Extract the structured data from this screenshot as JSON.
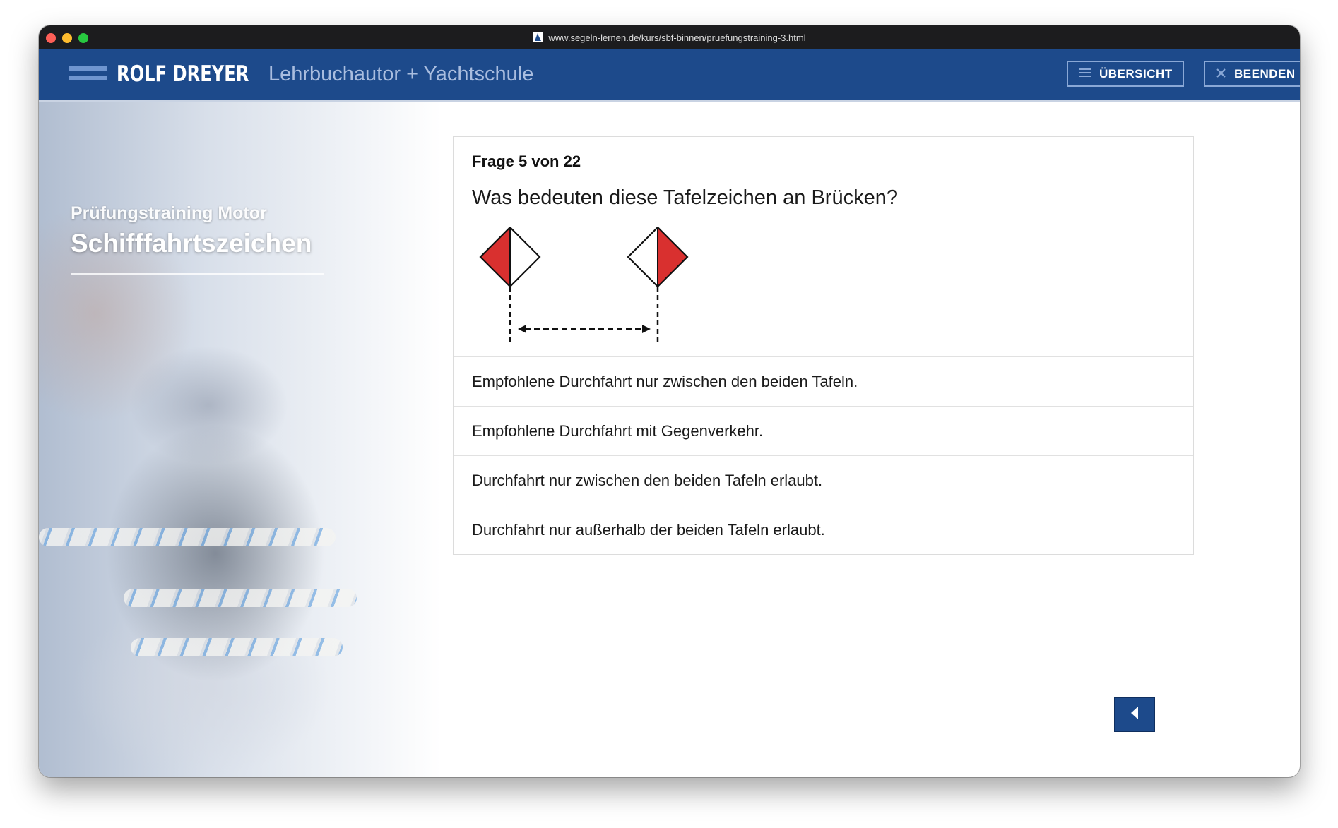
{
  "browser": {
    "url": "www.segeln-lernen.de/kurs/sbf-binnen/pruefungstraining-3.html",
    "favicon": "sailboat-icon"
  },
  "header": {
    "brand": "ROLF DREYER",
    "tagline": "Lehrbuchautor + Yachtschule",
    "overview_label": "ÜBERSICHT",
    "overview_icon": "menu-icon",
    "quit_label": "BEENDEN",
    "quit_icon": "close-icon",
    "bar_color": "#1d4a8b"
  },
  "sidebar": {
    "subtitle": "Prüfungstraining Motor",
    "title": "Schifffahrtszeichen"
  },
  "question": {
    "counter": "Frage 5 von 22",
    "text": "Was bedeuten diese Tafelzeichen an Brücken?",
    "answers": [
      "Empfohlene Durchfahrt nur zwischen den beiden Tafeln.",
      "Empfohlene Durchfahrt mit Gegenverkehr.",
      "Durchfahrt nur zwischen den beiden Tafeln erlaubt.",
      "Durchfahrt nur außerhalb der beiden Tafeln erlaubt."
    ],
    "sign_colors": {
      "red": "#d9302f",
      "white": "#ffffff"
    }
  },
  "nav": {
    "back_icon": "chevron-left-icon"
  }
}
